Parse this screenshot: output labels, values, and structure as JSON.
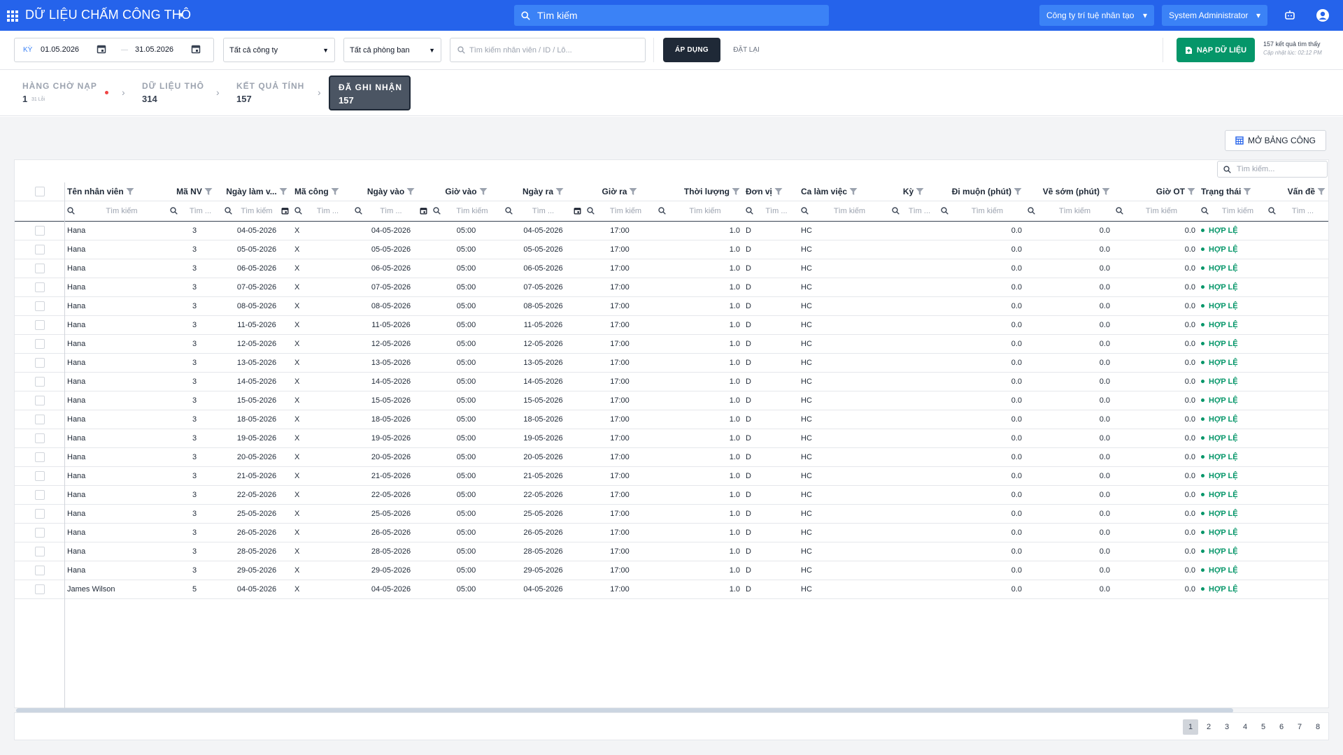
{
  "app": {
    "title": "DỮ LIỆU CHẤM CÔNG THÔ"
  },
  "top_search": {
    "placeholder": "Tìm kiếm"
  },
  "company_select": {
    "value": "Công ty trí tuệ nhân tạo"
  },
  "user_select": {
    "value": "System Administrator"
  },
  "filters": {
    "period_label": "KỲ",
    "date_from": "01.05.2026",
    "date_to": "31.05.2026",
    "company": "Tất cả công ty",
    "department": "Tất cả phòng ban",
    "search_placeholder": "Tìm kiếm nhân viên / ID / Lô...",
    "apply_label": "ÁP DỤNG",
    "reset_label": "ĐẶT LẠI",
    "load_label": "NẠP DỮ LIỆU",
    "result_count": "157 kết quả tìm thấy",
    "updated_at": "Cập nhật lúc: 02:12 PM"
  },
  "stepper": {
    "steps": [
      {
        "label": "HÀNG CHỜ NẠP",
        "count": "1",
        "sub": "31 Lỗi"
      },
      {
        "label": "DỮ LIỆU THÔ",
        "count": "314"
      },
      {
        "label": "KẾT QUẢ TÍNH",
        "count": "157"
      },
      {
        "label": "ĐÃ GHI NHẬN",
        "count": "157"
      }
    ],
    "active_index": 3
  },
  "open_sheet_label": "MỞ BẢNG CÔNG",
  "grid": {
    "search_placeholder": "Tìm kiếm...",
    "filter_placeholder": "Tìm kiếm",
    "filter_placeholder_short": "Tìm ...",
    "columns": [
      "Tên nhân viên",
      "Mã NV",
      "Ngày làm v...",
      "Mã công",
      "Ngày vào",
      "Giờ vào",
      "Ngày ra",
      "Giờ ra",
      "Thời lượng",
      "Đơn vị",
      "Ca làm việc",
      "Kỳ",
      "Đi muộn (phút)",
      "Về sớm (phút)",
      "Giờ OT",
      "Trạng thái",
      "Vấn đề"
    ],
    "rows": [
      {
        "name": "Hana",
        "emp_id": "3",
        "work_date": "04-05-2026",
        "code": "X",
        "date_in": "04-05-2026",
        "time_in": "05:00",
        "date_out": "04-05-2026",
        "time_out": "17:00",
        "duration": "1.0",
        "unit": "D",
        "shift": "HC",
        "late": "0.0",
        "early": "0.0",
        "ot": "0.0",
        "status": "HỢP LỆ"
      },
      {
        "name": "Hana",
        "emp_id": "3",
        "work_date": "05-05-2026",
        "code": "X",
        "date_in": "05-05-2026",
        "time_in": "05:00",
        "date_out": "05-05-2026",
        "time_out": "17:00",
        "duration": "1.0",
        "unit": "D",
        "shift": "HC",
        "late": "0.0",
        "early": "0.0",
        "ot": "0.0",
        "status": "HỢP LỆ"
      },
      {
        "name": "Hana",
        "emp_id": "3",
        "work_date": "06-05-2026",
        "code": "X",
        "date_in": "06-05-2026",
        "time_in": "05:00",
        "date_out": "06-05-2026",
        "time_out": "17:00",
        "duration": "1.0",
        "unit": "D",
        "shift": "HC",
        "late": "0.0",
        "early": "0.0",
        "ot": "0.0",
        "status": "HỢP LỆ"
      },
      {
        "name": "Hana",
        "emp_id": "3",
        "work_date": "07-05-2026",
        "code": "X",
        "date_in": "07-05-2026",
        "time_in": "05:00",
        "date_out": "07-05-2026",
        "time_out": "17:00",
        "duration": "1.0",
        "unit": "D",
        "shift": "HC",
        "late": "0.0",
        "early": "0.0",
        "ot": "0.0",
        "status": "HỢP LỆ"
      },
      {
        "name": "Hana",
        "emp_id": "3",
        "work_date": "08-05-2026",
        "code": "X",
        "date_in": "08-05-2026",
        "time_in": "05:00",
        "date_out": "08-05-2026",
        "time_out": "17:00",
        "duration": "1.0",
        "unit": "D",
        "shift": "HC",
        "late": "0.0",
        "early": "0.0",
        "ot": "0.0",
        "status": "HỢP LỆ"
      },
      {
        "name": "Hana",
        "emp_id": "3",
        "work_date": "11-05-2026",
        "code": "X",
        "date_in": "11-05-2026",
        "time_in": "05:00",
        "date_out": "11-05-2026",
        "time_out": "17:00",
        "duration": "1.0",
        "unit": "D",
        "shift": "HC",
        "late": "0.0",
        "early": "0.0",
        "ot": "0.0",
        "status": "HỢP LỆ"
      },
      {
        "name": "Hana",
        "emp_id": "3",
        "work_date": "12-05-2026",
        "code": "X",
        "date_in": "12-05-2026",
        "time_in": "05:00",
        "date_out": "12-05-2026",
        "time_out": "17:00",
        "duration": "1.0",
        "unit": "D",
        "shift": "HC",
        "late": "0.0",
        "early": "0.0",
        "ot": "0.0",
        "status": "HỢP LỆ"
      },
      {
        "name": "Hana",
        "emp_id": "3",
        "work_date": "13-05-2026",
        "code": "X",
        "date_in": "13-05-2026",
        "time_in": "05:00",
        "date_out": "13-05-2026",
        "time_out": "17:00",
        "duration": "1.0",
        "unit": "D",
        "shift": "HC",
        "late": "0.0",
        "early": "0.0",
        "ot": "0.0",
        "status": "HỢP LỆ"
      },
      {
        "name": "Hana",
        "emp_id": "3",
        "work_date": "14-05-2026",
        "code": "X",
        "date_in": "14-05-2026",
        "time_in": "05:00",
        "date_out": "14-05-2026",
        "time_out": "17:00",
        "duration": "1.0",
        "unit": "D",
        "shift": "HC",
        "late": "0.0",
        "early": "0.0",
        "ot": "0.0",
        "status": "HỢP LỆ"
      },
      {
        "name": "Hana",
        "emp_id": "3",
        "work_date": "15-05-2026",
        "code": "X",
        "date_in": "15-05-2026",
        "time_in": "05:00",
        "date_out": "15-05-2026",
        "time_out": "17:00",
        "duration": "1.0",
        "unit": "D",
        "shift": "HC",
        "late": "0.0",
        "early": "0.0",
        "ot": "0.0",
        "status": "HỢP LỆ"
      },
      {
        "name": "Hana",
        "emp_id": "3",
        "work_date": "18-05-2026",
        "code": "X",
        "date_in": "18-05-2026",
        "time_in": "05:00",
        "date_out": "18-05-2026",
        "time_out": "17:00",
        "duration": "1.0",
        "unit": "D",
        "shift": "HC",
        "late": "0.0",
        "early": "0.0",
        "ot": "0.0",
        "status": "HỢP LỆ"
      },
      {
        "name": "Hana",
        "emp_id": "3",
        "work_date": "19-05-2026",
        "code": "X",
        "date_in": "19-05-2026",
        "time_in": "05:00",
        "date_out": "19-05-2026",
        "time_out": "17:00",
        "duration": "1.0",
        "unit": "D",
        "shift": "HC",
        "late": "0.0",
        "early": "0.0",
        "ot": "0.0",
        "status": "HỢP LỆ"
      },
      {
        "name": "Hana",
        "emp_id": "3",
        "work_date": "20-05-2026",
        "code": "X",
        "date_in": "20-05-2026",
        "time_in": "05:00",
        "date_out": "20-05-2026",
        "time_out": "17:00",
        "duration": "1.0",
        "unit": "D",
        "shift": "HC",
        "late": "0.0",
        "early": "0.0",
        "ot": "0.0",
        "status": "HỢP LỆ"
      },
      {
        "name": "Hana",
        "emp_id": "3",
        "work_date": "21-05-2026",
        "code": "X",
        "date_in": "21-05-2026",
        "time_in": "05:00",
        "date_out": "21-05-2026",
        "time_out": "17:00",
        "duration": "1.0",
        "unit": "D",
        "shift": "HC",
        "late": "0.0",
        "early": "0.0",
        "ot": "0.0",
        "status": "HỢP LỆ"
      },
      {
        "name": "Hana",
        "emp_id": "3",
        "work_date": "22-05-2026",
        "code": "X",
        "date_in": "22-05-2026",
        "time_in": "05:00",
        "date_out": "22-05-2026",
        "time_out": "17:00",
        "duration": "1.0",
        "unit": "D",
        "shift": "HC",
        "late": "0.0",
        "early": "0.0",
        "ot": "0.0",
        "status": "HỢP LỆ"
      },
      {
        "name": "Hana",
        "emp_id": "3",
        "work_date": "25-05-2026",
        "code": "X",
        "date_in": "25-05-2026",
        "time_in": "05:00",
        "date_out": "25-05-2026",
        "time_out": "17:00",
        "duration": "1.0",
        "unit": "D",
        "shift": "HC",
        "late": "0.0",
        "early": "0.0",
        "ot": "0.0",
        "status": "HỢP LỆ"
      },
      {
        "name": "Hana",
        "emp_id": "3",
        "work_date": "26-05-2026",
        "code": "X",
        "date_in": "26-05-2026",
        "time_in": "05:00",
        "date_out": "26-05-2026",
        "time_out": "17:00",
        "duration": "1.0",
        "unit": "D",
        "shift": "HC",
        "late": "0.0",
        "early": "0.0",
        "ot": "0.0",
        "status": "HỢP LỆ"
      },
      {
        "name": "Hana",
        "emp_id": "3",
        "work_date": "28-05-2026",
        "code": "X",
        "date_in": "28-05-2026",
        "time_in": "05:00",
        "date_out": "28-05-2026",
        "time_out": "17:00",
        "duration": "1.0",
        "unit": "D",
        "shift": "HC",
        "late": "0.0",
        "early": "0.0",
        "ot": "0.0",
        "status": "HỢP LỆ"
      },
      {
        "name": "Hana",
        "emp_id": "3",
        "work_date": "29-05-2026",
        "code": "X",
        "date_in": "29-05-2026",
        "time_in": "05:00",
        "date_out": "29-05-2026",
        "time_out": "17:00",
        "duration": "1.0",
        "unit": "D",
        "shift": "HC",
        "late": "0.0",
        "early": "0.0",
        "ot": "0.0",
        "status": "HỢP LỆ"
      },
      {
        "name": "James Wilson",
        "emp_id": "5",
        "work_date": "04-05-2026",
        "code": "X",
        "date_in": "04-05-2026",
        "time_in": "05:00",
        "date_out": "04-05-2026",
        "time_out": "17:00",
        "duration": "1.0",
        "unit": "D",
        "shift": "HC",
        "late": "0.0",
        "early": "0.0",
        "ot": "0.0",
        "status": "HỢP LỆ"
      }
    ]
  },
  "pagination": {
    "pages": [
      "1",
      "2",
      "3",
      "4",
      "5",
      "6",
      "7",
      "8"
    ],
    "current": "1"
  },
  "colors": {
    "topbar": "#2563eb",
    "apply": "#1f2937",
    "load": "#059669",
    "status_ok": "#059669",
    "step_active": "#4b5563"
  }
}
